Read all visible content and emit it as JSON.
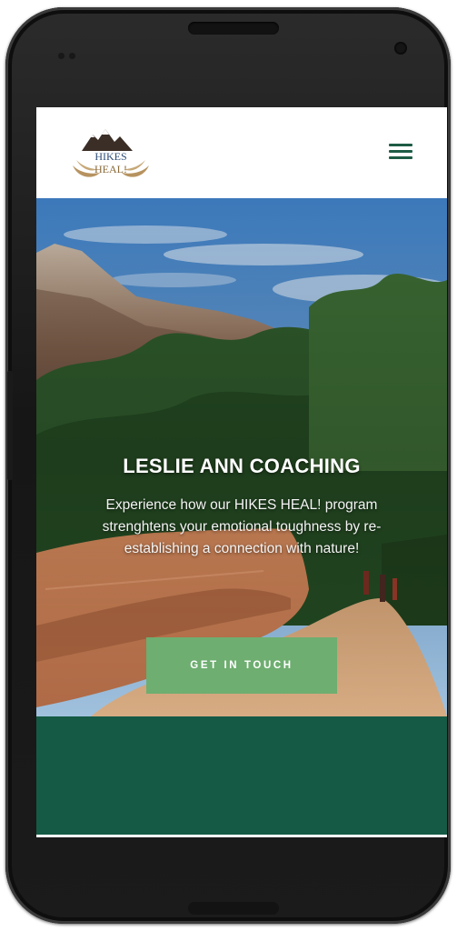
{
  "header": {
    "logo_line1": "HIKES",
    "logo_line2": "HEAL!",
    "menu_icon": "hamburger-menu-icon"
  },
  "hero": {
    "title": "LESLIE ANN COACHING",
    "subtitle": "Experience how our HIKES HEAL! program strenghtens your emotional toughness by re-establishing a connection with nature!",
    "cta_label": "GET IN TOUCH"
  },
  "colors": {
    "brand_green": "#155a45",
    "button_green": "#6eae70",
    "menu_green": "#1d5c45"
  }
}
